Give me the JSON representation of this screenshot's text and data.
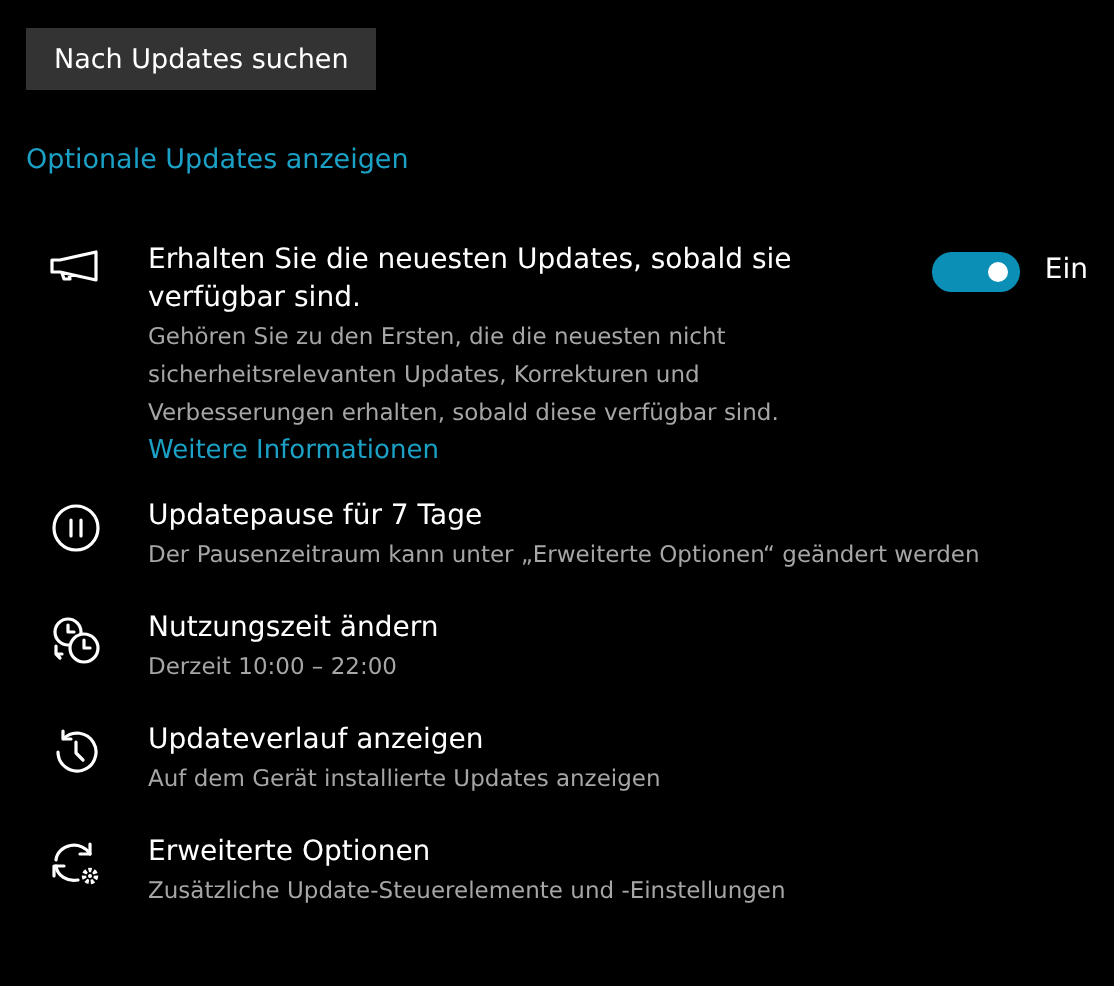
{
  "check_button": "Nach Updates suchen",
  "optional_link": "Optionale Updates anzeigen",
  "feature": {
    "title": "Erhalten Sie die neuesten Updates, sobald sie verfügbar sind.",
    "description": "Gehören Sie zu den Ersten, die die neuesten nicht sicherheitsrelevanten Updates, Korrekturen und Verbesserungen erhalten, sobald diese verfügbar sind.",
    "link": "Weitere Informationen",
    "on": true,
    "toggle_label": "Ein"
  },
  "items": [
    {
      "kind": "pause",
      "title": "Updatepause für 7 Tage",
      "subtitle": "Der Pausenzeitraum kann unter „Erweiterte Optionen“ geändert werden"
    },
    {
      "kind": "clock",
      "title": "Nutzungszeit ändern",
      "subtitle": "Derzeit 10:00 – 22:00"
    },
    {
      "kind": "history",
      "title": "Updateverlauf anzeigen",
      "subtitle": "Auf dem Gerät installierte Updates anzeigen"
    },
    {
      "kind": "advanced",
      "title": "Erweiterte Optionen",
      "subtitle": "Zusätzliche Update-Steuerelemente und -Einstellungen"
    }
  ]
}
